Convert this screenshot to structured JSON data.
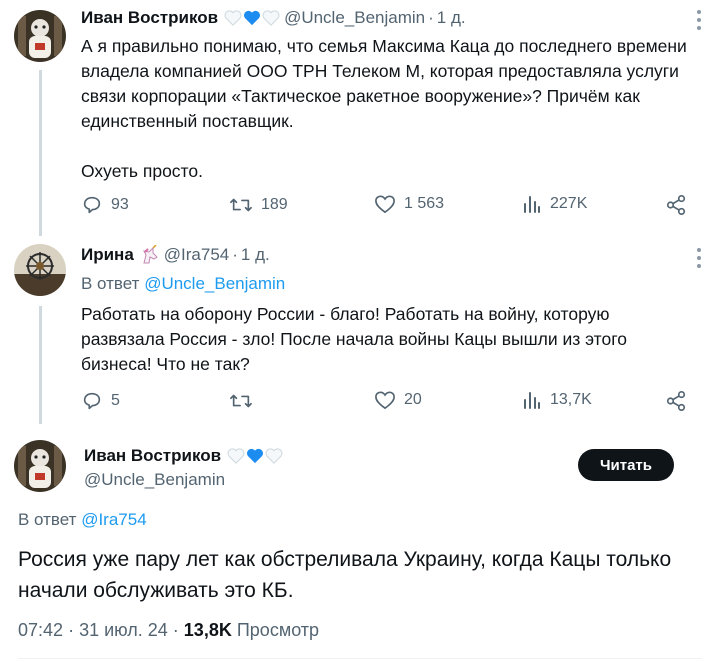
{
  "tweet1": {
    "name": "Иван Востриков",
    "handle": "@Uncle_Benjamin",
    "time": "1 д.",
    "text": "А я правильно понимаю, что семья Максима Каца до последнего времени владела компанией ООО ТРН Телеком М, которая предоставляла услуги связи корпорации «Тактическое ракетное вооружение»? Причём как единственный поставщик.\n\nОхуеть просто.",
    "replies": "93",
    "retweets": "189",
    "likes": "1 563",
    "views": "227K"
  },
  "tweet2": {
    "name": "Ирина",
    "handle": "@Ira754",
    "time": "1 д.",
    "reply_prefix": "В ответ",
    "reply_to": "@Uncle_Benjamin",
    "text": "Работать на оборону России - благо! Работать на войну, которую развязала Россия - зло! После начала войны Кацы вышли из этого бизнеса! Что не так?",
    "replies": "5",
    "retweets": "",
    "likes": "20",
    "views": "13,7K"
  },
  "main_tweet": {
    "name": "Иван Востриков",
    "handle": "@Uncle_Benjamin",
    "follow_label": "Читать",
    "reply_prefix": "В ответ",
    "reply_to": "@Ira754",
    "text": "Россия уже пару лет как обстреливала Украину, когда Кацы только начали обслуживать это КБ.",
    "time": "07:42",
    "date": "31 июл. 24",
    "views_count": "13,8K",
    "views_label": "Просмотр"
  },
  "icons": [
    "reply-icon",
    "retweet-icon",
    "like-icon",
    "views-icon",
    "share-icon",
    "more-icon",
    "white-heart-icon",
    "blue-heart-icon",
    "unicorn-icon"
  ],
  "colors": {
    "accent": "#1d9bf0",
    "muted": "#536471",
    "text": "#0f1419",
    "thread_line": "#cfd9de",
    "heart_blue": "#1d8cf0"
  }
}
